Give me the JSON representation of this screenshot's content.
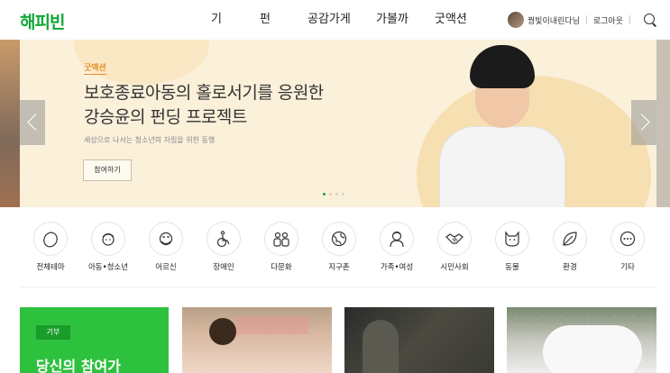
{
  "header": {
    "logo": "해피빈",
    "nav": [
      "기부",
      "펀딩",
      "공감가게",
      "가볼까",
      "굿액션"
    ],
    "user_name": "꿩빛이내린다님",
    "logout": "로그아웃"
  },
  "banner": {
    "tag": "굿액션",
    "title_line1": "보호종료아동의 홀로서기를 응원한",
    "title_line2": "강승윤의 펀딩 프로젝트",
    "subtitle": "세상으로 나서는 청소년의 자립을 위한 동행",
    "cta": "참여하기",
    "slide_count": 4,
    "active_slide": 1
  },
  "categories": [
    {
      "label": "전체테마",
      "icon": "leaf-egg-icon"
    },
    {
      "label": "아동•청소년",
      "icon": "child-icon"
    },
    {
      "label": "어르신",
      "icon": "elder-icon"
    },
    {
      "label": "장애인",
      "icon": "wheelchair-icon"
    },
    {
      "label": "다문화",
      "icon": "family-icon"
    },
    {
      "label": "지구촌",
      "icon": "globe-icon"
    },
    {
      "label": "가족•여성",
      "icon": "woman-icon"
    },
    {
      "label": "시민사회",
      "icon": "handshake-icon"
    },
    {
      "label": "동물",
      "icon": "cat-icon"
    },
    {
      "label": "환경",
      "icon": "leaf-icon"
    },
    {
      "label": "기타",
      "icon": "more-icon"
    }
  ],
  "cards": {
    "badge": "기부",
    "title": "당신의 참여가"
  },
  "colors": {
    "brand": "#10a836",
    "accent": "#e8902a",
    "card_green": "#2ec13e"
  }
}
